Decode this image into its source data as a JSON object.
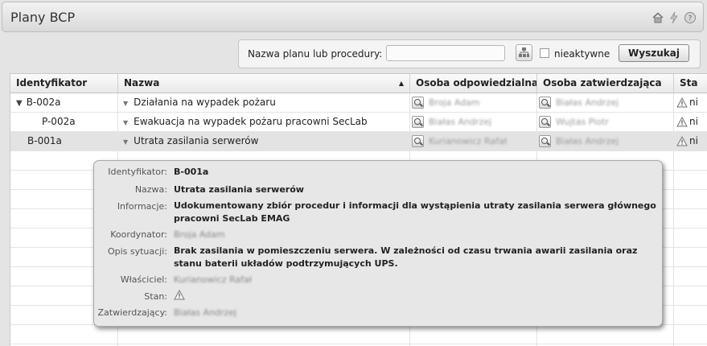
{
  "header": {
    "title": "Plany BCP",
    "icons": [
      "home-icon",
      "bolt-icon",
      "help-icon"
    ]
  },
  "search": {
    "label": "Nazwa planu lub procedury:",
    "value": "",
    "inactive_label": "nieaktywne",
    "search_button": "Wyszukaj"
  },
  "table": {
    "columns": [
      "Identyfikator",
      "Nazwa",
      "Osoba odpowiedzialna",
      "Osoba zatwierdzająca",
      "Sta"
    ],
    "sort_indicator": "▲",
    "rows": [
      {
        "id": "B-002a",
        "expander": "▼",
        "name": "Działania na wypadek pożaru",
        "responsible": "Broja Adam",
        "approver": "Białas Andrzej",
        "status": "ni"
      },
      {
        "id": "P-002a",
        "expander": "",
        "name": "Ewakuacja na wypadek pożaru pracowni SecLab",
        "responsible": "Białas Andrzej",
        "approver": "Wujtas Piotr",
        "status": "ni"
      },
      {
        "id": "B-001a",
        "expander": "",
        "name": "Utrata zasilania serwerów",
        "responsible": "Kurianowicz Rafał",
        "approver": "Białas Andrzej",
        "status": "ni"
      }
    ]
  },
  "tooltip": {
    "labels": {
      "id": "Identyfikator:",
      "name": "Nazwa:",
      "info": "Informacje:",
      "coordinator": "Koordynator:",
      "situation": "Opis sytuacji:",
      "owner": "Właściciel:",
      "state": "Stan:",
      "approver": "Zatwierdzający:"
    },
    "values": {
      "id": "B-001a",
      "name": "Utrata zasilania serwerów",
      "info": "Udokumentowany zbiór procedur i informacji dla wystąpienia utraty zasilania serwera głównego pracowni SecLab EMAG",
      "coordinator": "Broja Adam",
      "situation": "Brak zasilania w pomieszczeniu serwera. W zależności od czasu trwania awarii zasilania oraz stanu baterii układów podtrzymujących UPS.",
      "owner": "Kurianowicz Rafał",
      "approver": "Białas Andrzej"
    }
  }
}
